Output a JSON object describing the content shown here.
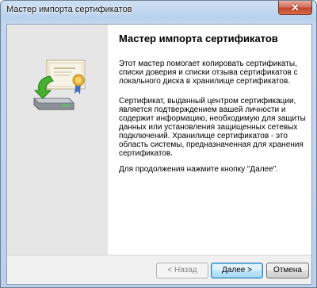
{
  "window": {
    "title": "Мастер импорта сертификатов",
    "close_label": "✕"
  },
  "panel": {
    "heading": "Мастер импорта сертификатов",
    "paragraphs": [
      "Этот мастер помогает копировать сертификаты, списки доверия и списки отзыва сертификатов с локального диска в хранилище сертификатов.",
      "Сертификат, выданный центром сертификации, является подтверждением вашей личности и содержит информацию, необходимую для защиты данных или установления защищенных сетевых подключений. Хранилище сертификатов - это область системы, предназначенная для хранения сертификатов.",
      "Для продолжения нажмите кнопку \"Далее\"."
    ],
    "icon": "certificate-import-icon"
  },
  "buttons": {
    "back": "< Назад",
    "next": "Далее >",
    "cancel": "Отмена"
  },
  "colors": {
    "title_bar": "#c4d7ee",
    "side_panel": "#e6e6e6",
    "close_button": "#c7482d",
    "default_button": "#3c7fb1"
  }
}
